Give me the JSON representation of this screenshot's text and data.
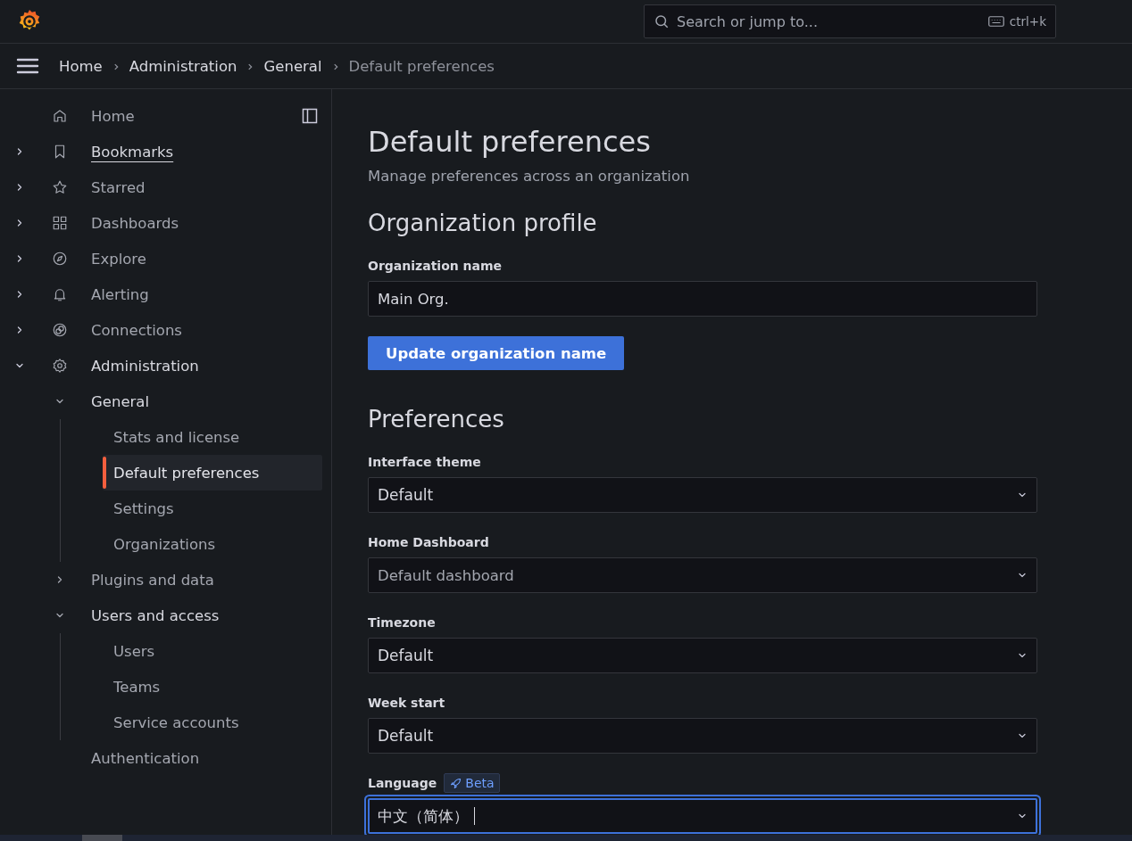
{
  "top_bar": {
    "search": {
      "placeholder": "Search or jump to...",
      "shortcut": "ctrl+k"
    }
  },
  "breadcrumbs": [
    {
      "label": "Home",
      "current": false
    },
    {
      "label": "Administration",
      "current": false
    },
    {
      "label": "General",
      "current": false
    },
    {
      "label": "Default preferences",
      "current": true
    }
  ],
  "sidebar": {
    "items": [
      {
        "label": "Home",
        "selected": false
      },
      {
        "label": "Bookmarks",
        "selected": false,
        "hovered": true,
        "expanded": false
      },
      {
        "label": "Starred",
        "selected": false,
        "expanded": false
      },
      {
        "label": "Dashboards",
        "selected": false,
        "expanded": false
      },
      {
        "label": "Explore",
        "selected": false,
        "expanded": false
      },
      {
        "label": "Alerting",
        "selected": false,
        "expanded": false
      },
      {
        "label": "Connections",
        "selected": false,
        "expanded": false
      },
      {
        "label": "Administration",
        "selected": false,
        "expanded": true,
        "children": [
          {
            "label": "General",
            "selected": false,
            "expanded": true,
            "children": [
              {
                "label": "Stats and license",
                "selected": false
              },
              {
                "label": "Default preferences",
                "selected": true
              },
              {
                "label": "Settings",
                "selected": false
              },
              {
                "label": "Organizations",
                "selected": false
              }
            ]
          },
          {
            "label": "Plugins and data",
            "selected": false,
            "expanded": false
          },
          {
            "label": "Users and access",
            "selected": false,
            "expanded": true,
            "children": [
              {
                "label": "Users",
                "selected": false
              },
              {
                "label": "Teams",
                "selected": false
              },
              {
                "label": "Service accounts",
                "selected": false
              }
            ]
          },
          {
            "label": "Authentication",
            "selected": false
          }
        ]
      }
    ]
  },
  "page": {
    "title": "Default preferences",
    "subtitle": "Manage preferences across an organization",
    "sections": [
      {
        "heading": "Organization profile",
        "fields": [
          {
            "kind": "input",
            "label": "Organization name",
            "value": "Main Org."
          }
        ],
        "button": "Update organization name"
      },
      {
        "heading": "Preferences",
        "fields": [
          {
            "kind": "select",
            "label": "Interface theme",
            "value": "Default"
          },
          {
            "kind": "select",
            "label": "Home Dashboard",
            "placeholder": "Default dashboard"
          },
          {
            "kind": "select",
            "label": "Timezone",
            "value": "Default"
          },
          {
            "kind": "select",
            "label": "Week start",
            "value": "Default"
          },
          {
            "kind": "select",
            "label": "Language",
            "badge": "Beta",
            "value": "中文（简体）",
            "focused": true
          }
        ]
      }
    ]
  }
}
